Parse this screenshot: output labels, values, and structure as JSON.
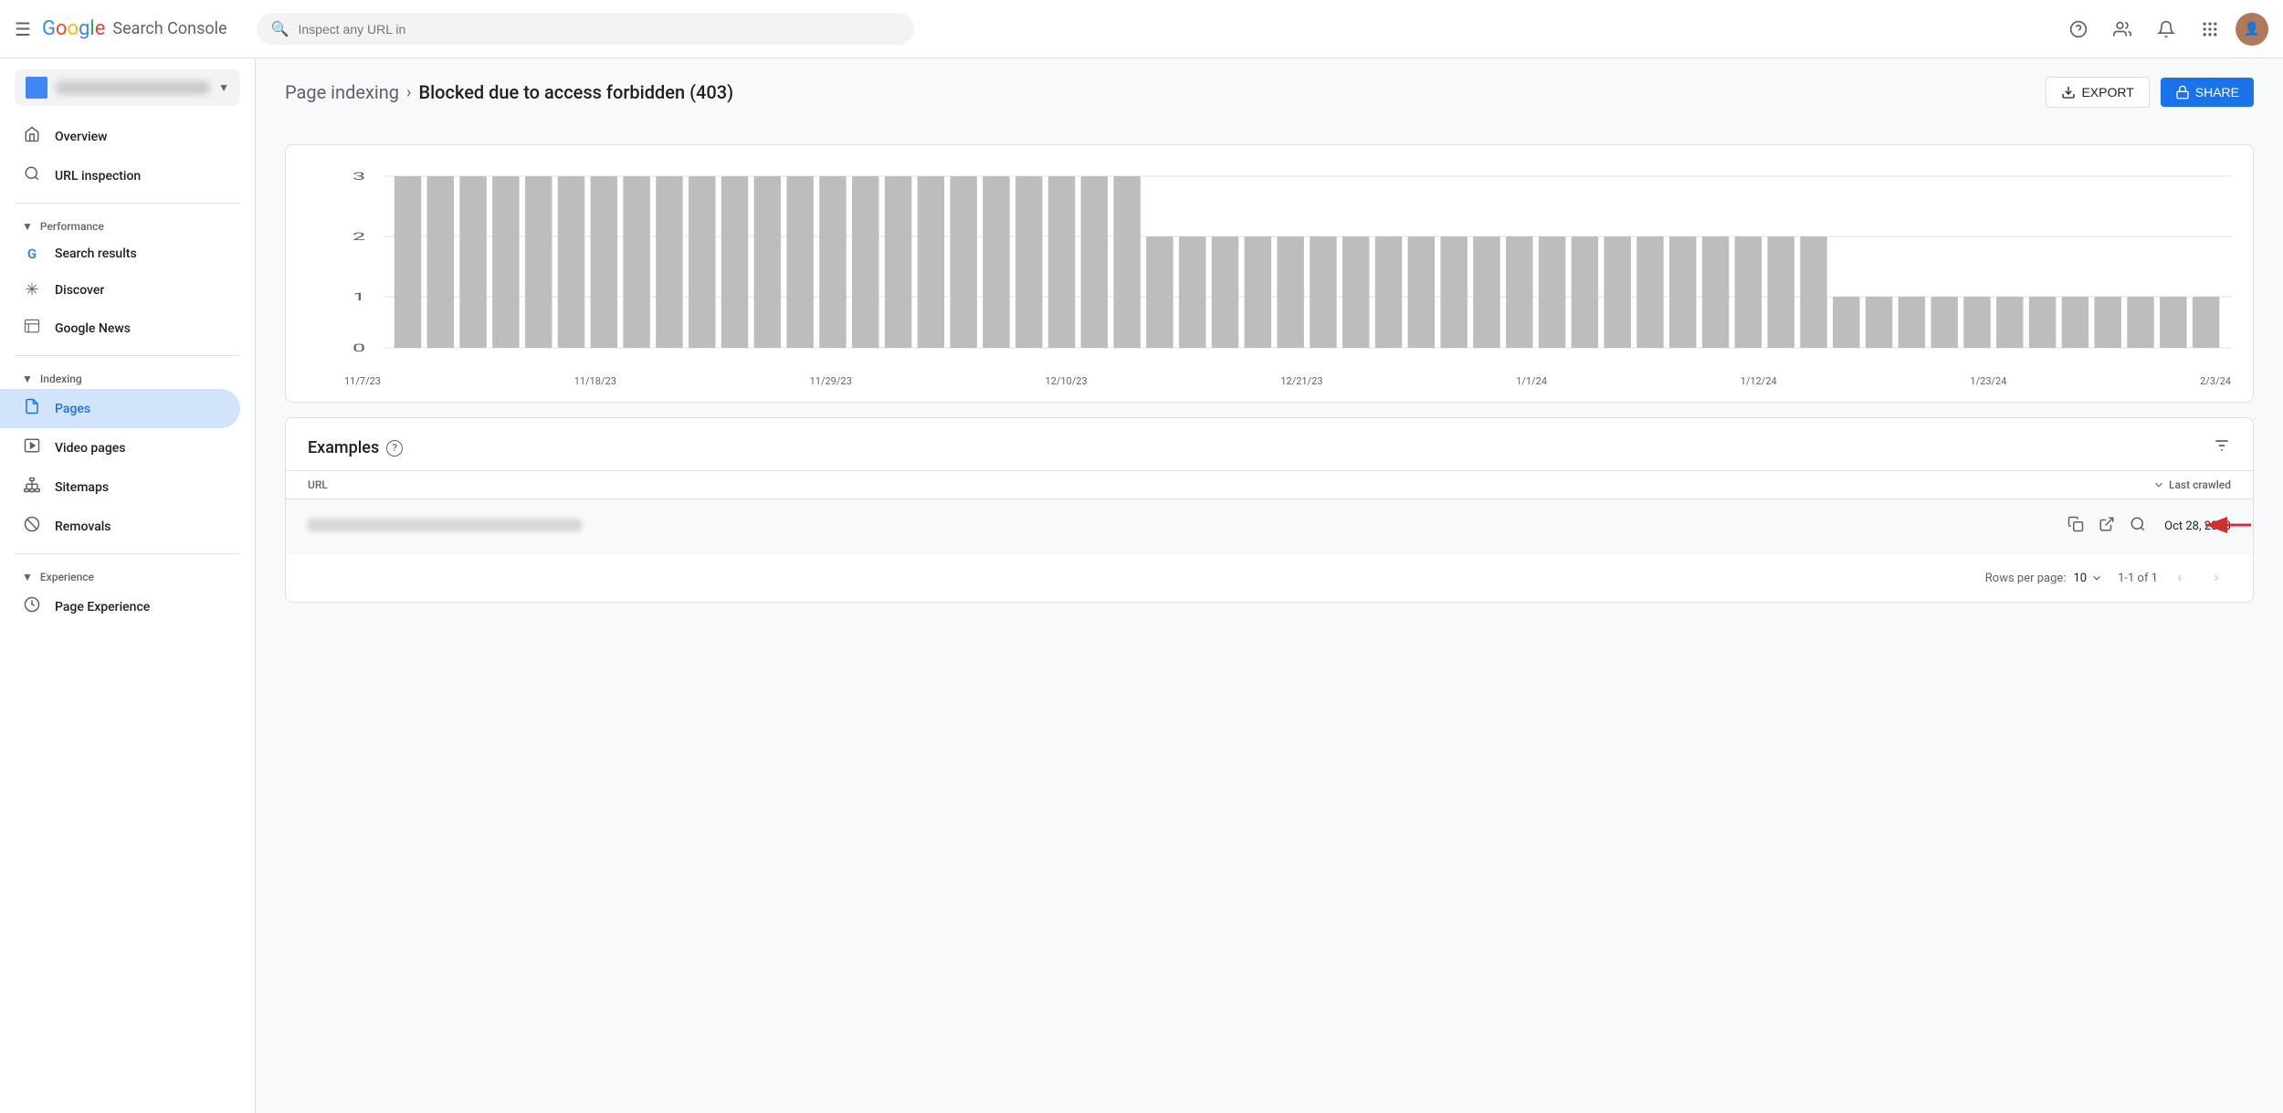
{
  "app": {
    "title": "Google Search Console",
    "logo": {
      "google": "Google",
      "sc": "Search Console"
    }
  },
  "topnav": {
    "search_placeholder": "Inspect any URL in",
    "search_value": ""
  },
  "sidebar": {
    "property_name": "example.com",
    "nav_items": [
      {
        "id": "overview",
        "label": "Overview",
        "icon": "🏠"
      },
      {
        "id": "url-inspection",
        "label": "URL inspection",
        "icon": "🔍"
      }
    ],
    "sections": [
      {
        "label": "Performance",
        "items": [
          {
            "id": "search-results",
            "label": "Search results",
            "icon": "G"
          },
          {
            "id": "discover",
            "label": "Discover",
            "icon": "✳"
          },
          {
            "id": "google-news",
            "label": "Google News",
            "icon": "📰"
          }
        ]
      },
      {
        "label": "Indexing",
        "items": [
          {
            "id": "pages",
            "label": "Pages",
            "icon": "📄",
            "active": true
          },
          {
            "id": "video-pages",
            "label": "Video pages",
            "icon": "🎬"
          },
          {
            "id": "sitemaps",
            "label": "Sitemaps",
            "icon": "🗺"
          },
          {
            "id": "removals",
            "label": "Removals",
            "icon": "🚫"
          }
        ]
      },
      {
        "label": "Experience",
        "items": [
          {
            "id": "page-experience",
            "label": "Page Experience",
            "icon": "⭕"
          }
        ]
      }
    ]
  },
  "breadcrumb": {
    "parent": "Page indexing",
    "current": "Blocked due to access forbidden (403)"
  },
  "actions": {
    "export_label": "EXPORT",
    "share_label": "SHARE"
  },
  "chart": {
    "y_labels": [
      "3",
      "2",
      "1",
      "0"
    ],
    "x_labels": [
      "11/7/23",
      "11/18/23",
      "11/29/23",
      "12/10/23",
      "12/21/23",
      "1/1/24",
      "1/12/24",
      "1/23/24",
      "2/3/24"
    ],
    "bars": [
      {
        "x": 0,
        "val": 3
      },
      {
        "x": 1,
        "val": 3
      },
      {
        "x": 2,
        "val": 3
      },
      {
        "x": 3,
        "val": 3
      },
      {
        "x": 4,
        "val": 3
      },
      {
        "x": 5,
        "val": 3
      },
      {
        "x": 6,
        "val": 3
      },
      {
        "x": 7,
        "val": 3
      },
      {
        "x": 8,
        "val": 3
      },
      {
        "x": 9,
        "val": 3
      },
      {
        "x": 10,
        "val": 3
      },
      {
        "x": 11,
        "val": 3
      },
      {
        "x": 12,
        "val": 3
      },
      {
        "x": 13,
        "val": 3
      },
      {
        "x": 14,
        "val": 3
      },
      {
        "x": 15,
        "val": 3
      },
      {
        "x": 16,
        "val": 3
      },
      {
        "x": 17,
        "val": 3
      },
      {
        "x": 18,
        "val": 3
      },
      {
        "x": 19,
        "val": 3
      },
      {
        "x": 20,
        "val": 3
      },
      {
        "x": 21,
        "val": 3
      },
      {
        "x": 22,
        "val": 3
      },
      {
        "x": 23,
        "val": 2
      },
      {
        "x": 24,
        "val": 2
      },
      {
        "x": 25,
        "val": 2
      },
      {
        "x": 26,
        "val": 2
      },
      {
        "x": 27,
        "val": 2
      },
      {
        "x": 28,
        "val": 2
      },
      {
        "x": 29,
        "val": 2
      },
      {
        "x": 30,
        "val": 2
      },
      {
        "x": 31,
        "val": 2
      },
      {
        "x": 32,
        "val": 2
      },
      {
        "x": 33,
        "val": 2
      },
      {
        "x": 34,
        "val": 2
      },
      {
        "x": 35,
        "val": 2
      },
      {
        "x": 36,
        "val": 2
      },
      {
        "x": 37,
        "val": 2
      },
      {
        "x": 38,
        "val": 2
      },
      {
        "x": 39,
        "val": 2
      },
      {
        "x": 40,
        "val": 2
      },
      {
        "x": 41,
        "val": 2
      },
      {
        "x": 42,
        "val": 2
      },
      {
        "x": 43,
        "val": 2
      },
      {
        "x": 44,
        "val": 1
      },
      {
        "x": 45,
        "val": 1
      },
      {
        "x": 46,
        "val": 1
      },
      {
        "x": 47,
        "val": 1
      },
      {
        "x": 48,
        "val": 1
      },
      {
        "x": 49,
        "val": 1
      },
      {
        "x": 50,
        "val": 1
      },
      {
        "x": 51,
        "val": 1
      },
      {
        "x": 52,
        "val": 1
      },
      {
        "x": 53,
        "val": 1
      },
      {
        "x": 54,
        "val": 1
      },
      {
        "x": 55,
        "val": 1
      }
    ]
  },
  "examples": {
    "title": "Examples",
    "table_header_url": "URL",
    "table_header_crawled": "Last crawled",
    "rows": [
      {
        "url_blurred": true,
        "date": "Oct 28, 2023"
      }
    ],
    "rows_per_page_label": "Rows per page:",
    "rows_per_page_value": "10",
    "pagination": "1-1 of 1"
  }
}
